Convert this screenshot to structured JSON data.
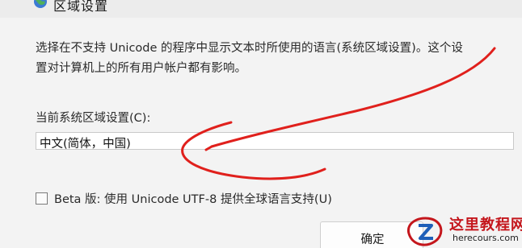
{
  "dialog": {
    "title": "区域设置",
    "description_lines": [
      "选择在不支持 Unicode 的程序中显示文本时所使用的语言(系统区域设置)。这个设",
      "置对计算机上的所有用户帐户都有影响。"
    ],
    "current_locale_label": "当前系统区域设置(C):",
    "current_locale_value": "中文(简体，中国)",
    "beta_checkbox_label": "Beta 版: 使用 Unicode UTF-8 提供全球语言支持(U)",
    "beta_checked": false,
    "ok_button_label": "确定"
  },
  "annotation": {
    "color": "#e0201c"
  },
  "watermark": {
    "site_name": "这里教程网",
    "url": "herecours.com"
  }
}
